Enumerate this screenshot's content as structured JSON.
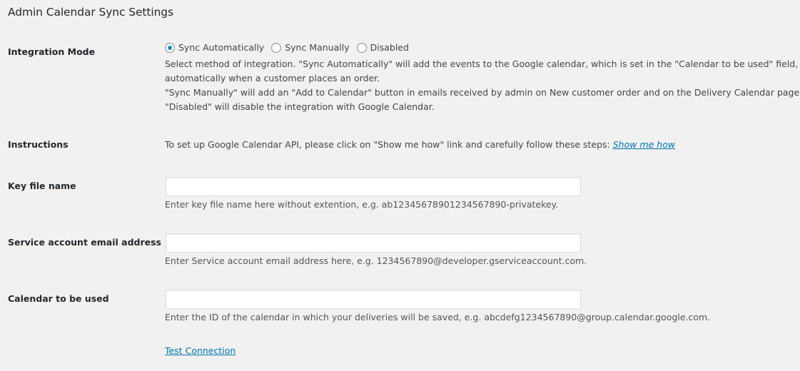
{
  "page": {
    "title": "Admin Calendar Sync Settings"
  },
  "integration_mode": {
    "label": "Integration Mode",
    "options": [
      {
        "label": "Sync Automatically",
        "checked": true
      },
      {
        "label": "Sync Manually",
        "checked": false
      },
      {
        "label": "Disabled",
        "checked": false
      }
    ],
    "description": [
      "Select method of integration. \"Sync Automatically\" will add the events to the Google calendar, which is set in the \"Calendar to be used\" field,",
      "automatically when a customer places an order.",
      "\"Sync Manually\" will add an \"Add to Calendar\" button in emails received by admin on New customer order and on the Delivery Calendar page.",
      "\"Disabled\" will disable the integration with Google Calendar."
    ]
  },
  "instructions": {
    "label": "Instructions",
    "text": "To set up Google Calendar API, please click on \"Show me how\" link and carefully follow these steps: ",
    "link_label": "Show me how"
  },
  "key_file": {
    "label": "Key file name",
    "value": "",
    "help": "Enter key file name here without extention, e.g. ab12345678901234567890-privatekey."
  },
  "service_email": {
    "label": "Service account email address",
    "value": "",
    "help": "Enter Service account email address here, e.g. 1234567890@developer.gserviceaccount.com."
  },
  "calendar": {
    "label": "Calendar to be used",
    "value": "",
    "help": "Enter the ID of the calendar in which your deliveries will be saved, e.g. abcdefg1234567890@group.calendar.google.com."
  },
  "test_connection": {
    "label": "Test Connection"
  },
  "colors": {
    "background": "#f1f1f1",
    "link": "#0073aa",
    "radio_checked": "#1e8cbe"
  }
}
